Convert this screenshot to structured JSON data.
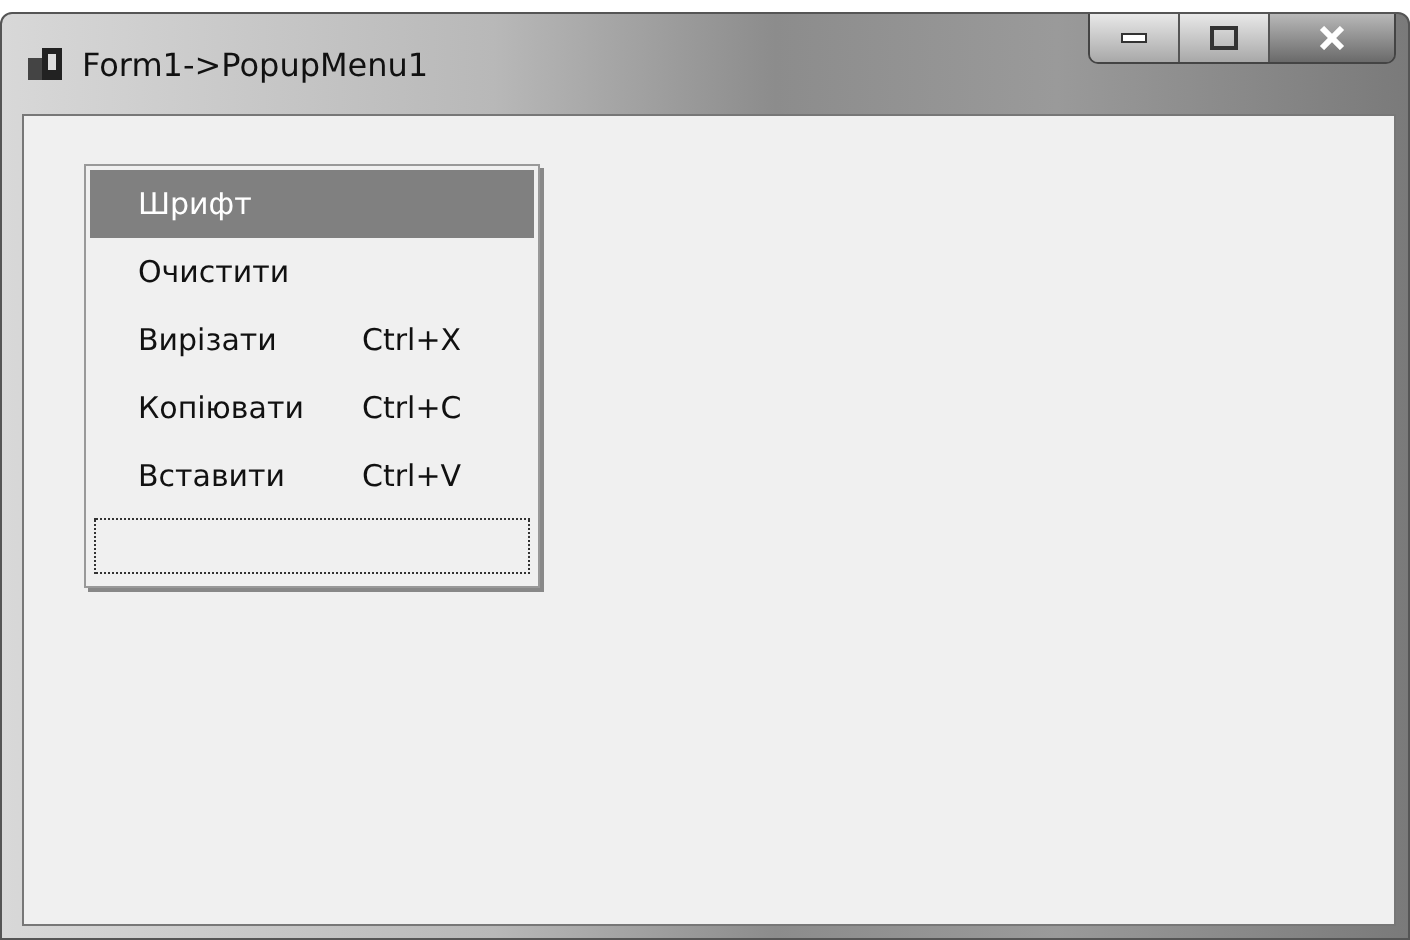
{
  "window": {
    "title": "Form1->PopupMenu1"
  },
  "menu": {
    "items": [
      {
        "kind": "item",
        "label": "Шрифт",
        "selected": true
      },
      {
        "kind": "item",
        "label": "Очистити",
        "selected": false
      },
      {
        "kind": "item",
        "label": "Вирізати",
        "shortcut": "Ctrl+X",
        "selected": false
      },
      {
        "kind": "item",
        "label": "Копіювати",
        "shortcut": "Ctrl+C",
        "selected": false
      },
      {
        "kind": "item",
        "label": "Вставити",
        "shortcut": "Ctrl+V",
        "selected": false
      },
      {
        "kind": "new_slot",
        "selected": false
      }
    ]
  }
}
